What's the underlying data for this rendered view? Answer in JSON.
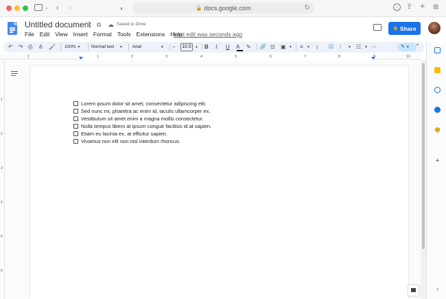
{
  "browser": {
    "url": "docs.google.com",
    "traffic_lights": [
      "#ff5f57",
      "#febc2e",
      "#28c840"
    ]
  },
  "doc": {
    "title": "Untitled document",
    "saved_status": "Saved to Drive",
    "last_edit": "Last edit was seconds ago",
    "share_label": "Share"
  },
  "menu": [
    "File",
    "Edit",
    "View",
    "Insert",
    "Format",
    "Tools",
    "Extensions",
    "Help"
  ],
  "toolbar": {
    "zoom": "100%",
    "style": "Normal text",
    "font": "Arial",
    "font_size": "10.5"
  },
  "ruler": {
    "numbers": [
      "1",
      "1",
      "2",
      "3",
      "4",
      "5",
      "6",
      "7",
      "8",
      "9",
      "10"
    ]
  },
  "vruler": {
    "numbers": [
      "1",
      "2",
      "3",
      "4",
      "5",
      "6"
    ]
  },
  "checklist": [
    "Lorem ipsum dolor sit amet, consectetur adipiscing elit.",
    "Sed nunc mi, pharetra ac enim id, iaculis ullamcorper ex.",
    "Vestibulum sit amet enim a magna mollis consectetur.",
    "Nulla tempus libero at ipsum congue facilisis id at sapien.",
    "Etiam eu lacinia ex, at efficitur sapien.",
    "Vivamus non elit non nisl interdum rhoncus."
  ],
  "colors": {
    "accent": "#1a73e8",
    "toolbar_bg": "#edf2fa"
  }
}
